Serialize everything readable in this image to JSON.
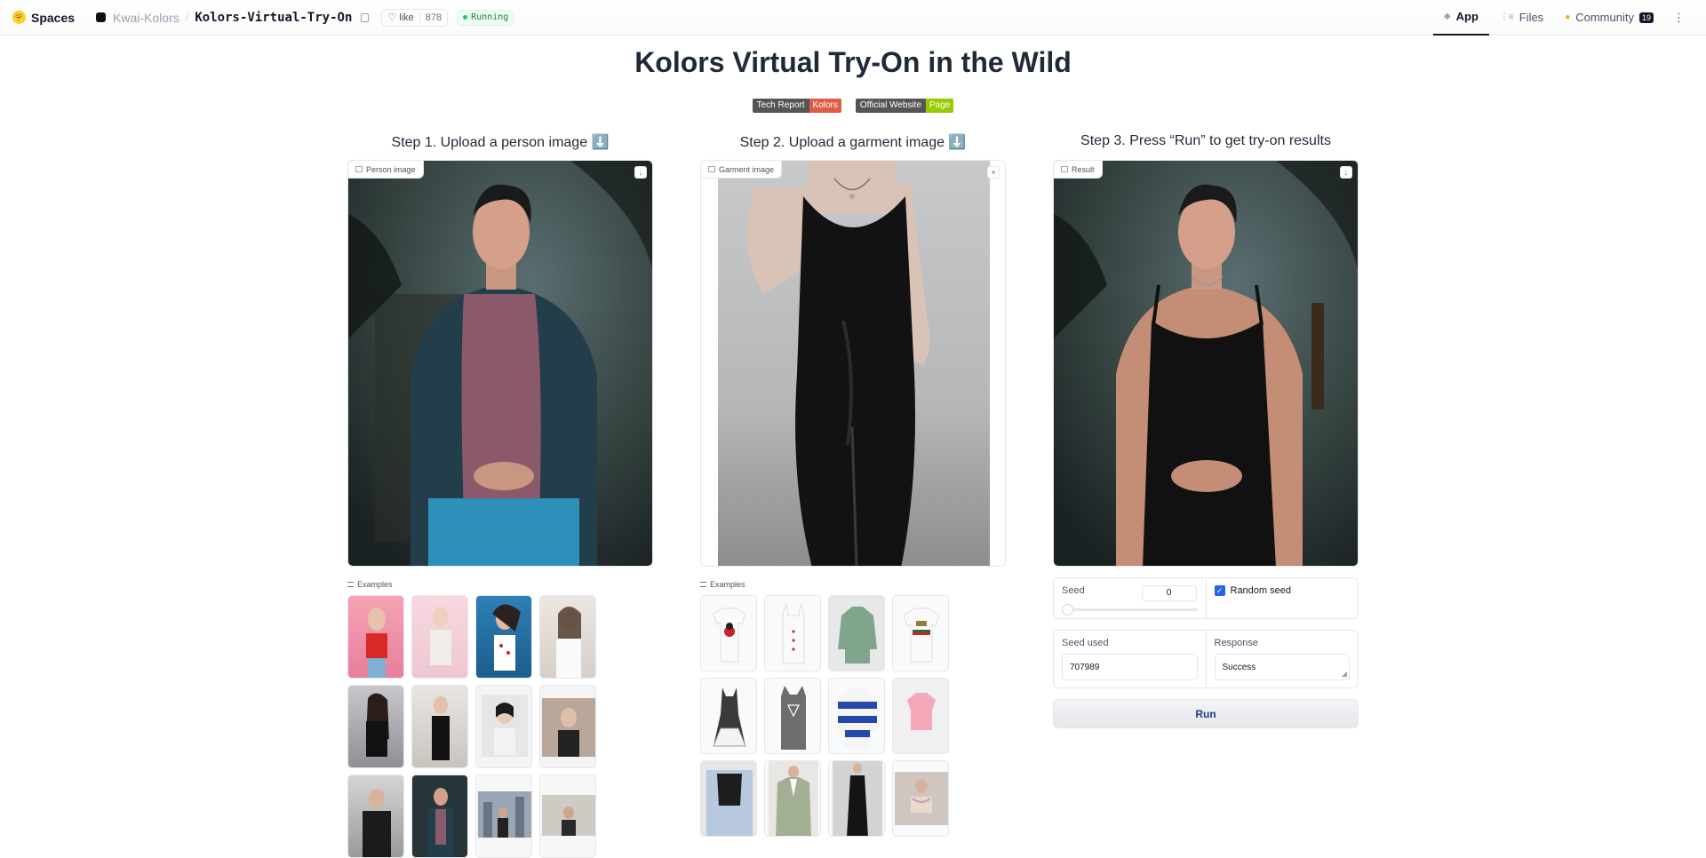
{
  "topbar": {
    "brand": "Spaces",
    "owner": "Kwai-Kolors",
    "repo": "Kolors-Virtual-Try-On",
    "like_label": "like",
    "like_count": "878",
    "status": "Running",
    "tabs": [
      {
        "label": "App",
        "icon": "app-icon",
        "active": true
      },
      {
        "label": "Files",
        "icon": "files-icon",
        "active": false
      },
      {
        "label": "Community",
        "icon": "community-icon",
        "active": false,
        "badge": "19"
      }
    ]
  },
  "page": {
    "title": "Kolors Virtual Try-On in the Wild",
    "badges": [
      {
        "left": "Tech Report",
        "right": "Kolors",
        "color": "#e05d44"
      },
      {
        "left": "Official Website",
        "right": "Page",
        "color": "#97ca00"
      }
    ]
  },
  "steps": {
    "step1": "Step 1. Upload a person image ⬇️",
    "step2": "Step 2. Upload a garment image ⬇️",
    "step3": "Step 3. Press “Run” to get try-on results"
  },
  "person": {
    "label": "Person image",
    "examples_label": "Examples",
    "thumb_count": 12
  },
  "garment": {
    "label": "Garment image",
    "examples_label": "Examples",
    "thumb_count": 12
  },
  "result": {
    "label": "Result"
  },
  "controls": {
    "seed_label": "Seed",
    "seed_value": "0",
    "random_seed_label": "Random seed",
    "random_seed_checked": true,
    "seed_used_label": "Seed used",
    "seed_used_value": "707989",
    "response_label": "Response",
    "response_value": "Success",
    "run_label": "Run"
  }
}
